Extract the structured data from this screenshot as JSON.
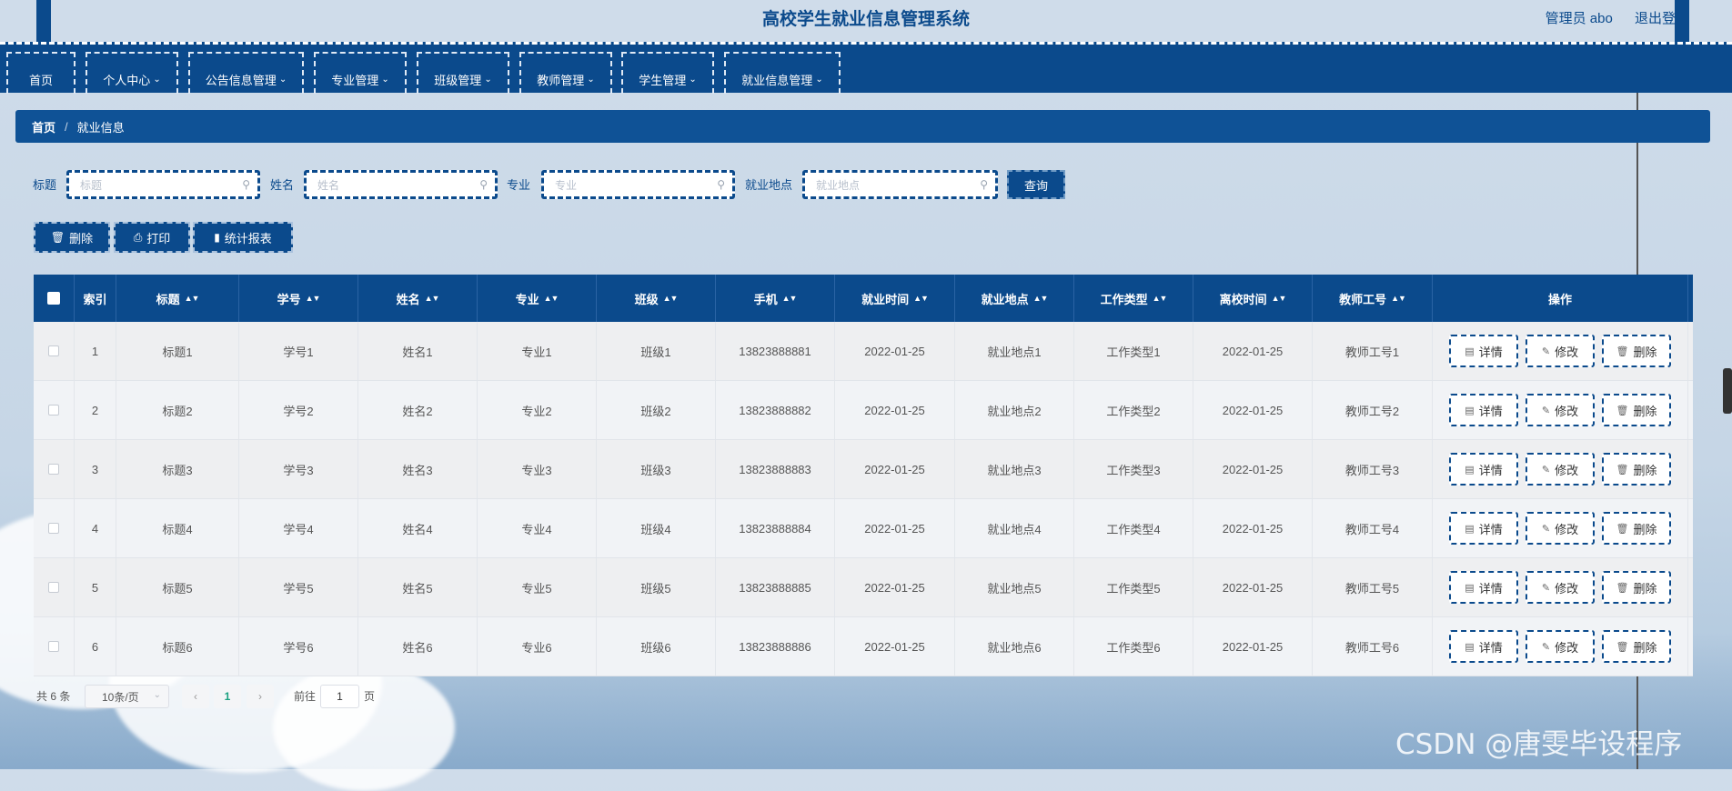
{
  "header": {
    "title": "高校学生就业信息管理系统",
    "user_label": "管理员 abo",
    "logout_label": "退出登"
  },
  "nav": {
    "items": [
      {
        "label": "首页",
        "has_dropdown": false
      },
      {
        "label": "个人中心",
        "has_dropdown": true
      },
      {
        "label": "公告信息管理",
        "has_dropdown": true
      },
      {
        "label": "专业管理",
        "has_dropdown": true
      },
      {
        "label": "班级管理",
        "has_dropdown": true
      },
      {
        "label": "教师管理",
        "has_dropdown": true
      },
      {
        "label": "学生管理",
        "has_dropdown": true
      },
      {
        "label": "就业信息管理",
        "has_dropdown": true
      }
    ],
    "chevron": "⌄"
  },
  "breadcrumb": {
    "home": "首页",
    "separator": "/",
    "current": "就业信息"
  },
  "search": {
    "fields": [
      {
        "label": "标题",
        "placeholder": "标题"
      },
      {
        "label": "姓名",
        "placeholder": "姓名"
      },
      {
        "label": "专业",
        "placeholder": "专业"
      },
      {
        "label": "就业地点",
        "placeholder": "就业地点"
      }
    ],
    "submit_label": "查询"
  },
  "toolbar": {
    "delete_label": "删除",
    "print_label": "打印",
    "report_label": "统计报表"
  },
  "table": {
    "columns": [
      "索引",
      "标题",
      "学号",
      "姓名",
      "专业",
      "班级",
      "手机",
      "就业时间",
      "就业地点",
      "工作类型",
      "离校时间",
      "教师工号",
      "操作"
    ],
    "sortable": [
      false,
      true,
      true,
      true,
      true,
      true,
      true,
      true,
      true,
      true,
      true,
      true,
      false
    ],
    "rows": [
      [
        "1",
        "标题1",
        "学号1",
        "姓名1",
        "专业1",
        "班级1",
        "13823888881",
        "2022-01-25",
        "就业地点1",
        "工作类型1",
        "2022-01-25",
        "教师工号1"
      ],
      [
        "2",
        "标题2",
        "学号2",
        "姓名2",
        "专业2",
        "班级2",
        "13823888882",
        "2022-01-25",
        "就业地点2",
        "工作类型2",
        "2022-01-25",
        "教师工号2"
      ],
      [
        "3",
        "标题3",
        "学号3",
        "姓名3",
        "专业3",
        "班级3",
        "13823888883",
        "2022-01-25",
        "就业地点3",
        "工作类型3",
        "2022-01-25",
        "教师工号3"
      ],
      [
        "4",
        "标题4",
        "学号4",
        "姓名4",
        "专业4",
        "班级4",
        "13823888884",
        "2022-01-25",
        "就业地点4",
        "工作类型4",
        "2022-01-25",
        "教师工号4"
      ],
      [
        "5",
        "标题5",
        "学号5",
        "姓名5",
        "专业5",
        "班级5",
        "13823888885",
        "2022-01-25",
        "就业地点5",
        "工作类型5",
        "2022-01-25",
        "教师工号5"
      ],
      [
        "6",
        "标题6",
        "学号6",
        "姓名6",
        "专业6",
        "班级6",
        "13823888886",
        "2022-01-25",
        "就业地点6",
        "工作类型6",
        "2022-01-25",
        "教师工号6"
      ]
    ],
    "actions": {
      "detail": "详情",
      "edit": "修改",
      "delete": "删除"
    }
  },
  "pagination": {
    "total_text": "共 6 条",
    "page_size": "10条/页",
    "prev": "‹",
    "current_page": "1",
    "next": "›",
    "goto_label": "前往",
    "goto_value": "1",
    "page_unit": "页"
  },
  "watermark": "CSDN @唐雯毕设程序",
  "colors": {
    "primary": "#0b4a8c",
    "breadcrumb": "#0f5296",
    "background": "#cfdcea"
  }
}
